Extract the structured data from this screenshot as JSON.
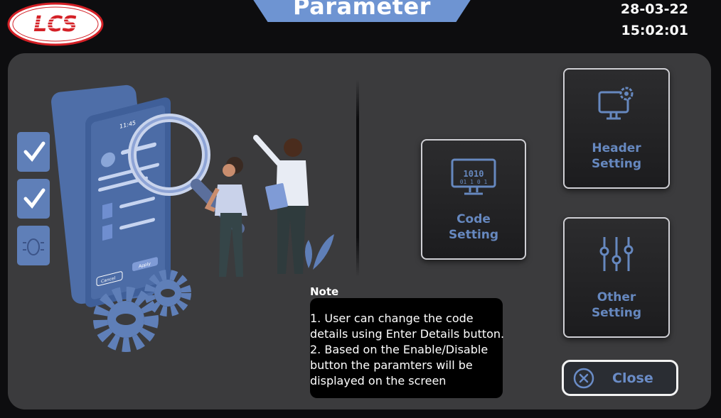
{
  "header": {
    "logo_text": "LCS",
    "title": "Parameter",
    "date": "28-03-22",
    "time": "15:02:01"
  },
  "tiles": {
    "code": {
      "label": "Code\nSetting",
      "icon": "binary-monitor-icon"
    },
    "header": {
      "label": "Header\nSetting",
      "icon": "monitor-gear-icon"
    },
    "other": {
      "label": "Other\nSetting",
      "icon": "sliders-icon"
    }
  },
  "note": {
    "title": "Note",
    "lines": [
      "1. User can change the code",
      "details using Enter Details button.",
      "2. Based on the Enable/Disable",
      "button the paramters will be",
      "displayed on the screen"
    ]
  },
  "close_button": {
    "label": "Close",
    "icon": "close-circle-icon"
  },
  "illustration": {
    "phone_time": "11:45",
    "cancel_label": "Cancel",
    "apply_label": "Apply"
  },
  "colors": {
    "accent": "#6e94d2",
    "tile_label": "#6688bf",
    "panel": "#3b3b3d",
    "background": "#0d0d0f",
    "logo_red": "#d42026"
  }
}
